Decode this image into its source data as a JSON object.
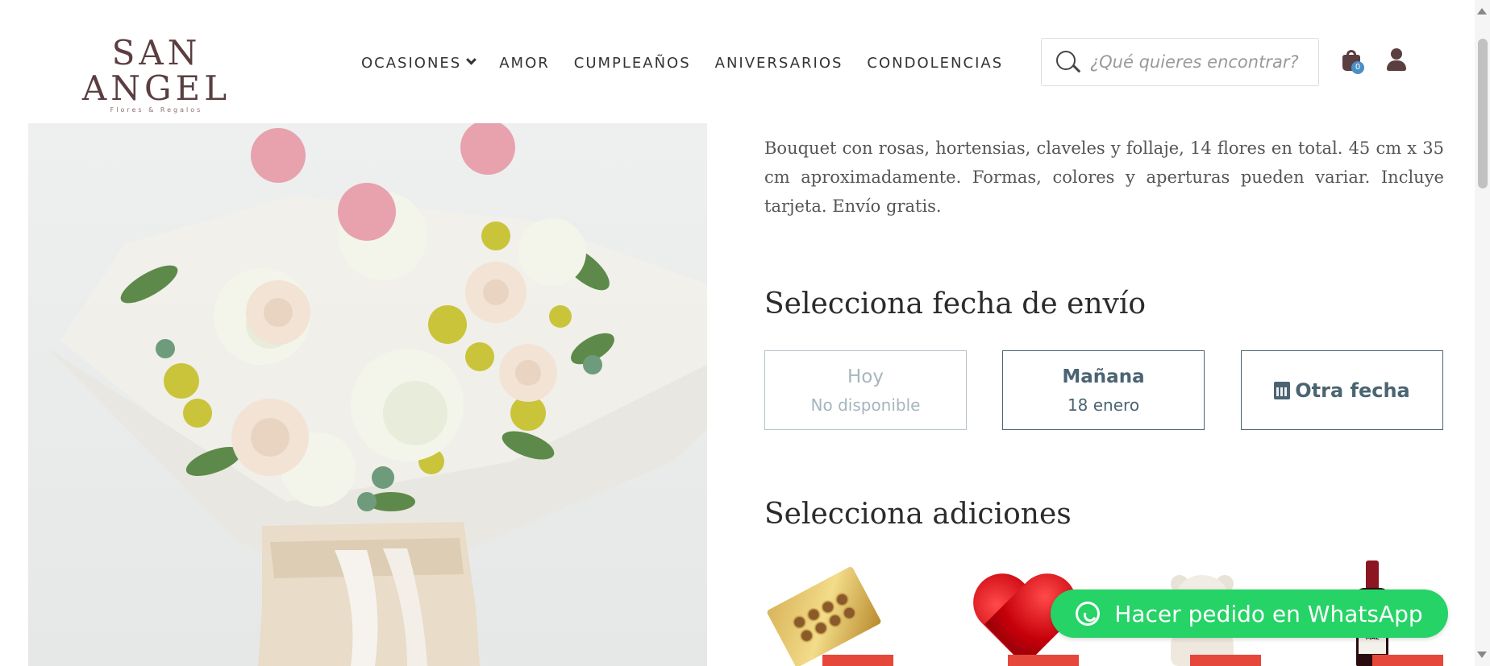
{
  "header": {
    "logo": {
      "name": "SAN ANGEL",
      "tagline": "Flores & Regalos"
    },
    "nav": [
      {
        "label": "OCASIONES",
        "has_dropdown": true
      },
      {
        "label": "AMOR"
      },
      {
        "label": "CUMPLEAÑOS"
      },
      {
        "label": "ANIVERSARIOS"
      },
      {
        "label": "CONDOLENCIAS"
      }
    ],
    "search": {
      "placeholder": "¿Qué quieres encontrar?"
    },
    "cart": {
      "count": "0",
      "icon": "shopping-bag-icon"
    },
    "account": {
      "icon": "user-icon"
    }
  },
  "product": {
    "image_alt": "Bouquet con rosas, hortensias, claveles y follaje",
    "description": "Bouquet con rosas, hortensias, claveles y follaje, 14 flores en total. 45  cm x 35 cm aproximadamente. Formas, colores y aperturas pueden variar. Incluye tarjeta. Envío gratis."
  },
  "shipping": {
    "title": "Selecciona fecha de envío",
    "options": [
      {
        "title": "Hoy",
        "subtitle": "No disponible",
        "disabled": true
      },
      {
        "title": "Mañana",
        "subtitle": "18 enero",
        "disabled": false
      },
      {
        "title": "Otra fecha",
        "icon": "calendar-icon"
      }
    ]
  },
  "additions": {
    "title": "Selecciona adiciones",
    "items": [
      {
        "name": "chocolates"
      },
      {
        "name": "globo-corazon"
      },
      {
        "name": "peluche"
      },
      {
        "name": "vino",
        "label_text": "FINCA LAS MORAS MAL"
      }
    ]
  },
  "whatsapp": {
    "label": "Hacer pedido en WhatsApp",
    "color": "#25d366"
  },
  "colors": {
    "brand": "#5a3e40",
    "accent": "#4b6472",
    "badge": "#4a90c8",
    "sale_tag": "#e5483a"
  }
}
